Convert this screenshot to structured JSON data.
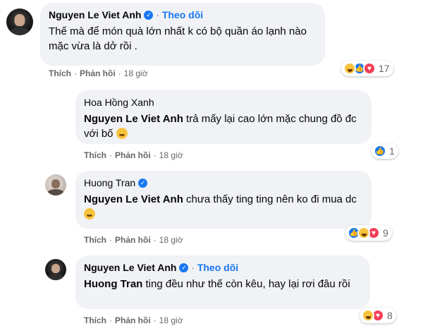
{
  "comments": [
    {
      "author": "Nguyen Le Viet Anh",
      "verified": true,
      "follow_label": "Theo dõi",
      "mention": "",
      "text": "Thế mà để món quà lớn nhất k có bộ quần áo lạnh nào mặc vừa là dở rồi .",
      "actions": {
        "like": "Thích",
        "reply": "Phản hồi",
        "time": "18 giờ"
      },
      "reactions": [
        "haha",
        "like",
        "love"
      ],
      "reaction_count": "17"
    },
    {
      "author": "Hoa Hồng Xanh",
      "verified": false,
      "follow_label": "",
      "mention": "Nguyen Le Viet Anh",
      "text": "trả mấy lại cao lớn mặc chung đồ đc với bố",
      "actions": {
        "like": "Thích",
        "reply": "Phản hồi",
        "time": "18 giờ"
      },
      "reactions": [
        "like"
      ],
      "reaction_count": "1"
    },
    {
      "author": "Huong Tran",
      "verified": true,
      "follow_label": "",
      "mention": "Nguyen Le Viet Anh",
      "text": "chưa thấy ting ting nên ko đi mua dc",
      "actions": {
        "like": "Thích",
        "reply": "Phản hồi",
        "time": "18 giờ"
      },
      "reactions": [
        "like",
        "haha",
        "love"
      ],
      "reaction_count": "9"
    },
    {
      "author": "Nguyen Le Viet Anh",
      "verified": true,
      "follow_label": "Theo dõi",
      "mention": "Huong Tran",
      "text": "ting đều như thế còn kêu, hay lại rơi đâu rồi",
      "actions": {
        "like": "Thích",
        "reply": "Phản hồi",
        "time": "18 giờ"
      },
      "reactions": [
        "haha",
        "love"
      ],
      "reaction_count": "8"
    }
  ],
  "colors": {
    "bubble": "#f0f2f5",
    "link": "#1877f2",
    "meta": "#65676b"
  }
}
